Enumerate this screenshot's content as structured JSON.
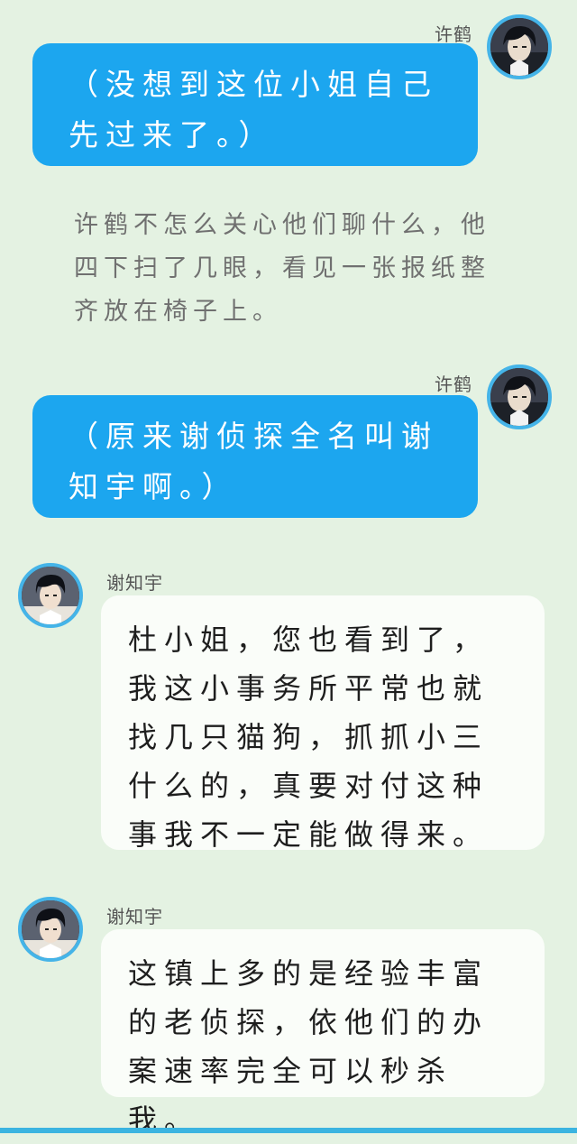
{
  "messages": [
    {
      "sender": "许鹤",
      "side": "right",
      "text": "（没想到这位小姐自己先过来了。）"
    },
    {
      "sender": "许鹤",
      "side": "right",
      "text": "（原来谢侦探全名叫谢知宇啊。）"
    },
    {
      "sender": "谢知宇",
      "side": "left",
      "text": "杜小姐，您也看到了，我这小事务所平常也就找几只猫狗，抓抓小三什么的，真要对付这种事我不一定能做得来。"
    },
    {
      "sender": "谢知宇",
      "side": "left",
      "text": "这镇上多的是经验丰富的老侦探，依他们的办案速率完全可以秒杀我。"
    }
  ],
  "narration": "许鹤不怎么关心他们聊什么，他四下扫了几眼，看见一张报纸整齐放在椅子上。",
  "colors": {
    "background": "#e4f2e2",
    "right_bubble": "#1ca6ef",
    "left_bubble": "#fafdf9",
    "avatar_ring": "#45b4e8"
  }
}
